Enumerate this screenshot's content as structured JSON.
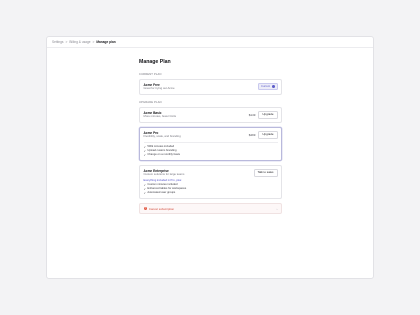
{
  "breadcrumb": {
    "items": [
      "Settings",
      "Billing & usage"
    ],
    "separator": ">",
    "current": "Manage plan"
  },
  "page": {
    "title": "Manage Plan"
  },
  "current_plan": {
    "section_label": "CURRENT PLAN",
    "name": "Acme Free",
    "description": "Great for trying out Acme",
    "badge": "Current"
  },
  "upgrade": {
    "section_label": "UPGRADE PLAN",
    "plans": [
      {
        "name": "Acme Basic",
        "description": "More minutes, fewer limits",
        "price": "$149",
        "button": "Upgrade"
      },
      {
        "name": "Acme Pro",
        "description": "Flexibility, scale, and branding",
        "price": "$499",
        "button": "Upgrade",
        "features": [
          "500k minutes included",
          "Upload custom branding",
          "Change on a monthly basis"
        ]
      },
      {
        "name": "Acme Enterprise",
        "description": "Custom solutions for large teams",
        "button": "Talk to sales",
        "included_link": "Everything included in Pro, plus:",
        "features": [
          "Custom minutes included",
          "Enhanced tables for workspaces",
          "Automated user groups"
        ]
      }
    ]
  },
  "cancel": {
    "label": "Cancel subscription",
    "chevron": "›"
  },
  "colors": {
    "accent": "#5a5ac8",
    "danger": "#d24a3a",
    "background": "#f3f3f5"
  },
  "icons": {
    "check": "✓",
    "warning": "!"
  }
}
